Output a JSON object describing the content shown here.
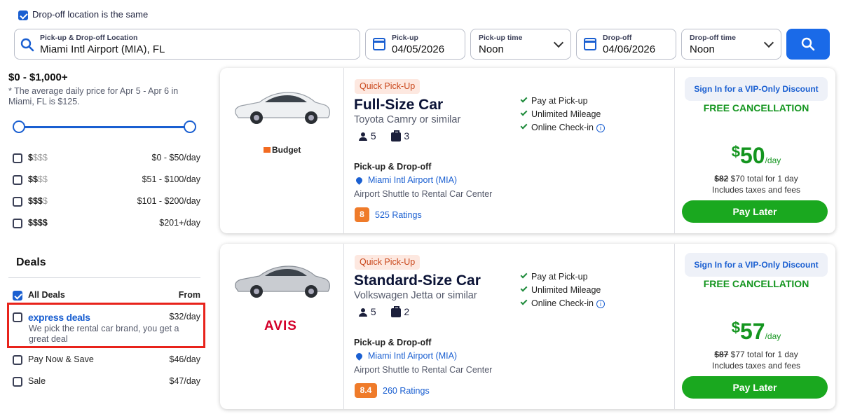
{
  "search": {
    "same_dropoff_label": "Drop-off location is the same",
    "location_label": "Pick-up & Drop-off Location",
    "location_value": "Miami Intl Airport (MIA), FL",
    "pickup_label": "Pick-up",
    "pickup_date": "04/05/2026",
    "pickup_time_label": "Pick-up time",
    "pickup_time": "Noon",
    "dropoff_label": "Drop-off",
    "dropoff_date": "04/06/2026",
    "dropoff_time_label": "Drop-off time",
    "dropoff_time": "Noon"
  },
  "filters": {
    "price_range": "$0 - $1,000+",
    "price_note": "* The average daily price for Apr 5 - Apr 6 in Miami, FL is $125.",
    "price_levels": [
      {
        "strong": "$",
        "light": "$$$",
        "range": "$0 - $50/day"
      },
      {
        "strong": "$$",
        "light": "$$",
        "range": "$51 - $100/day"
      },
      {
        "strong": "$$$",
        "light": "$",
        "range": "$101 - $200/day"
      },
      {
        "strong": "$$$$",
        "light": "",
        "range": "$201+/day"
      }
    ],
    "deals_heading": "Deals",
    "all_deals_label": "All Deals",
    "from_label": "From",
    "express_label_a": "express",
    "express_label_b": "deals",
    "express_price": "$32/day",
    "express_desc": "We pick the rental car brand, you get a great deal",
    "pay_now_label": "Pay Now & Save",
    "pay_now_price": "$46/day",
    "sale_label": "Sale",
    "sale_price": "$47/day"
  },
  "cars": [
    {
      "brand": "Budget",
      "badge": "Quick Pick-Up",
      "class": "Full-Size Car",
      "model": "Toyota Camry or similar",
      "seats": "5",
      "bags": "3",
      "features": [
        "Pay at Pick-up",
        "Unlimited Mileage",
        "Online Check-in"
      ],
      "pickup_heading": "Pick-up & Drop-off",
      "location": "Miami Intl Airport (MIA)",
      "shuttle": "Airport Shuttle to Rental Car Center",
      "rating": "8",
      "ratings_count": "525 Ratings",
      "vip": "Sign In for a VIP-Only Discount",
      "free_cancel": "FREE CANCELLATION",
      "currency": "$",
      "price": "50",
      "per_day": "/day",
      "old_total": "$82",
      "total_note": "$70 total for 1 day",
      "taxes": "Includes taxes and fees",
      "cta": "Pay Later"
    },
    {
      "brand": "AVIS",
      "badge": "Quick Pick-Up",
      "class": "Standard-Size Car",
      "model": "Volkswagen Jetta or similar",
      "seats": "5",
      "bags": "2",
      "features": [
        "Pay at Pick-up",
        "Unlimited Mileage",
        "Online Check-in"
      ],
      "pickup_heading": "Pick-up & Drop-off",
      "location": "Miami Intl Airport (MIA)",
      "shuttle": "Airport Shuttle to Rental Car Center",
      "rating": "8.4",
      "ratings_count": "260 Ratings",
      "vip": "Sign In for a VIP-Only Discount",
      "free_cancel": "FREE CANCELLATION",
      "currency": "$",
      "price": "57",
      "per_day": "/day",
      "old_total": "$87",
      "total_note": "$77 total for 1 day",
      "taxes": "Includes taxes and fees",
      "cta": "Pay Later"
    }
  ],
  "colors": {
    "accent": "#1a5fd1",
    "green": "#14951f",
    "highlight_box": "#e8231b"
  }
}
